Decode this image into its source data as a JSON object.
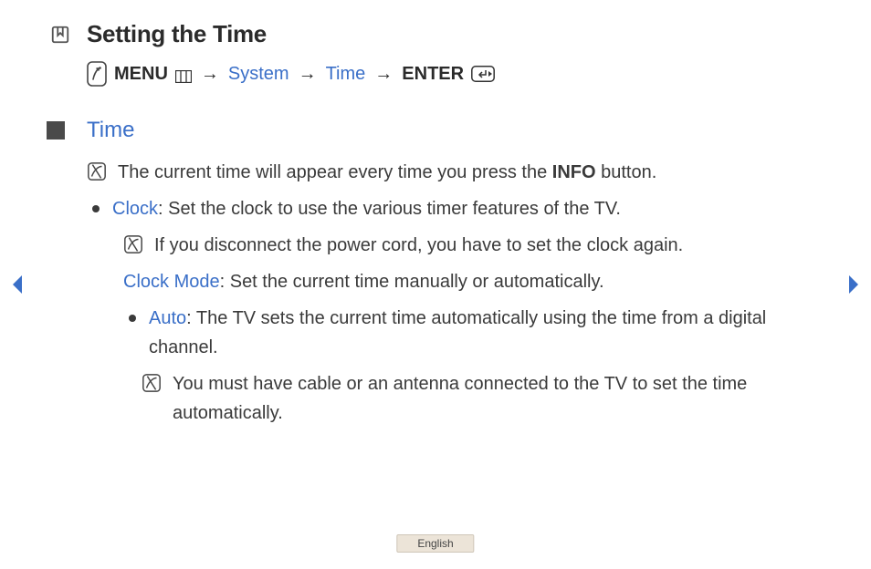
{
  "title": "Setting the Time",
  "breadcrumb": {
    "menu_label": "MENU",
    "parts": [
      "System",
      "Time"
    ],
    "enter_label": "ENTER",
    "arrow": "→"
  },
  "section_title": "Time",
  "notes": {
    "info_line_pre": "The current time will appear every time you press the ",
    "info_bold": "INFO",
    "info_line_post": " button.",
    "clock_label": "Clock",
    "clock_desc": ": Set the clock to use the various timer features of the TV.",
    "disconnect_note": "If you disconnect the power cord, you have to set the clock again.",
    "clock_mode_label": "Clock Mode",
    "clock_mode_desc": ": Set the current time manually or automatically.",
    "auto_label": "Auto",
    "auto_desc": ": The TV sets the current time automatically using the time from a digital channel.",
    "antenna_note": "You must have cable or an antenna connected to the TV to set the time automatically."
  },
  "language": "English"
}
